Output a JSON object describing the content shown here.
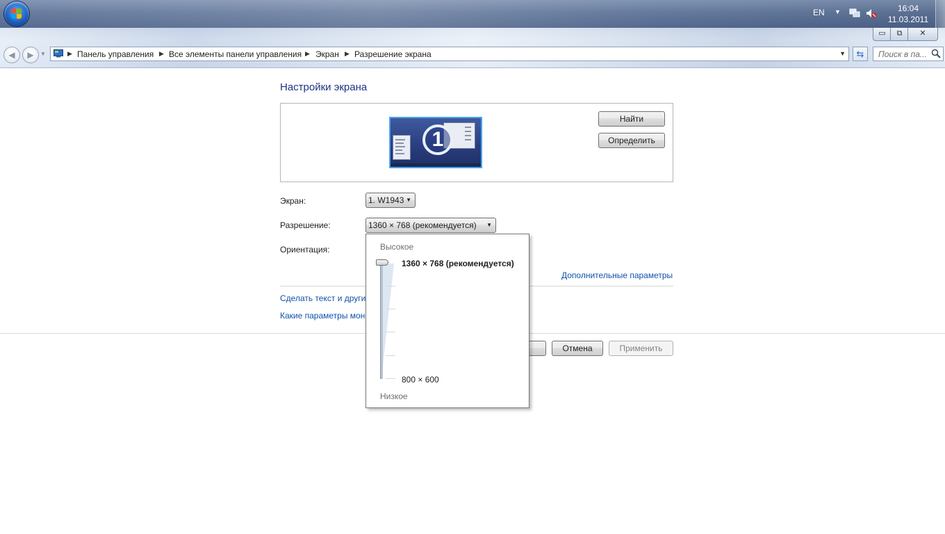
{
  "taskbar": {
    "language": "EN",
    "time": "16:04",
    "date": "11.03.2011",
    "icons": [
      "windows-logo-icon",
      "network-icon",
      "volume-muted-icon"
    ]
  },
  "window": {
    "min_label": "▭",
    "max_label": "⧉",
    "close_label": "✕"
  },
  "nav": {
    "back_label": "◀",
    "forward_label": "▶"
  },
  "address": {
    "crumbs": [
      "Панель управления",
      "Все элементы панели управления",
      "Экран",
      "Разрешение экрана"
    ],
    "separator": "▶",
    "dropdown_arrow": "▼"
  },
  "search": {
    "placeholder": "Поиск в па..."
  },
  "content": {
    "title": "Настройки экрана",
    "monitor_number": "1",
    "find_button": "Найти",
    "identify_button": "Определить",
    "screen_label": "Экран:",
    "screen_value": "1. W1943",
    "resolution_label": "Разрешение:",
    "resolution_value": "1360 × 768 (рекомендуется)",
    "orientation_label": "Ориентация:",
    "advanced_link": "Дополнительные параметры",
    "text_size_link": "Сделать текст и другие",
    "which_params_link": "Какие параметры мон",
    "cancel_button": "Отмена",
    "apply_button": "Применить"
  },
  "dropdown": {
    "high_label": "Высокое",
    "low_label": "Низкое",
    "max_resolution": "1360 × 768 (рекомендуется)",
    "min_resolution": "800 × 600",
    "slider_fraction": 1.0
  },
  "colors": {
    "link": "#0f52a8",
    "title": "#1e3287",
    "taskbar": "#5e7498"
  }
}
